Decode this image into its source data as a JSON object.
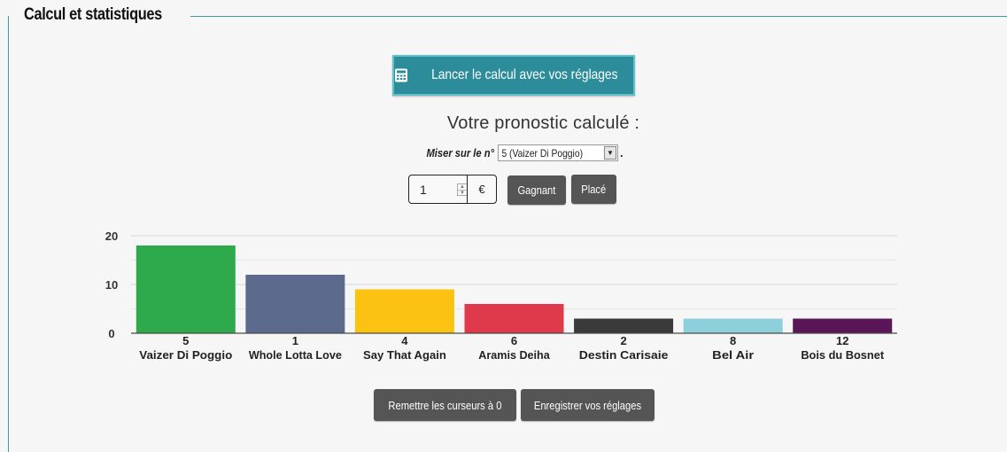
{
  "section": {
    "title": "Calcul et statistiques"
  },
  "calc_button": {
    "label": "Lancer le calcul avec vos réglages",
    "icon": "calculator-icon"
  },
  "prono": {
    "title": "Votre pronostic calculé :",
    "miser_label": "Miser sur le n°",
    "selected": "5 (Vaizer Di Poggio)",
    "trailing": "."
  },
  "stake": {
    "value": "1",
    "currency": "€"
  },
  "bet_buttons": {
    "gagnant": "Gagnant",
    "place": "Placé"
  },
  "footer_buttons": {
    "reset": "Remettre les curseurs à 0",
    "save": "Enregistrer vos réglages"
  },
  "colors": {
    "accent": "#2c8c99",
    "button_dark": "#555555"
  },
  "chart_data": {
    "type": "bar",
    "ylim": [
      0,
      20
    ],
    "yticks": [
      "20",
      "10",
      "0"
    ],
    "grid": true,
    "categories": [
      {
        "num": "5",
        "name": "Vaizer Di Poggio",
        "value": 18,
        "color": "#2ea94b"
      },
      {
        "num": "1",
        "name": "Whole Lotta Love",
        "value": 12,
        "color": "#5b6a8d"
      },
      {
        "num": "4",
        "name": "Say That Again",
        "value": 9,
        "color": "#fbc212"
      },
      {
        "num": "6",
        "name": "Aramis Deiha",
        "value": 6,
        "color": "#de3a4b"
      },
      {
        "num": "2",
        "name": "Destin Carisaie",
        "value": 3,
        "color": "#3a3a3a"
      },
      {
        "num": "8",
        "name": "Bel Air",
        "value": 3,
        "color": "#8ecfdc"
      },
      {
        "num": "12",
        "name": "Bois du Bosnet",
        "value": 3,
        "color": "#5a1758"
      }
    ]
  }
}
